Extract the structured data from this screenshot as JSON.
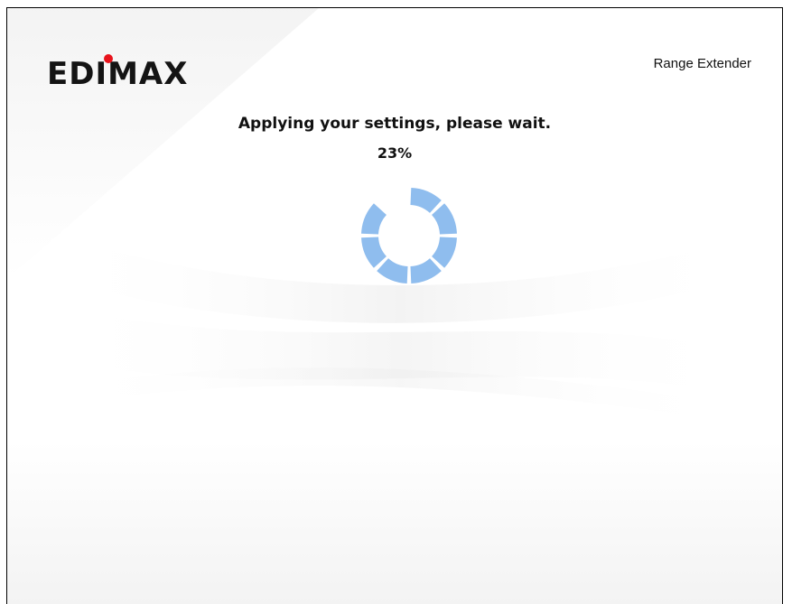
{
  "header": {
    "logo_text": "EDIMAX",
    "product_name": "Range Extender"
  },
  "progress": {
    "message": "Applying your settings, please wait.",
    "percent_label": "23%",
    "percent": 23
  },
  "spinner": {
    "icon": "loading-spinner-icon",
    "color": "#8fbdee",
    "dot_color": "#e8141c"
  }
}
